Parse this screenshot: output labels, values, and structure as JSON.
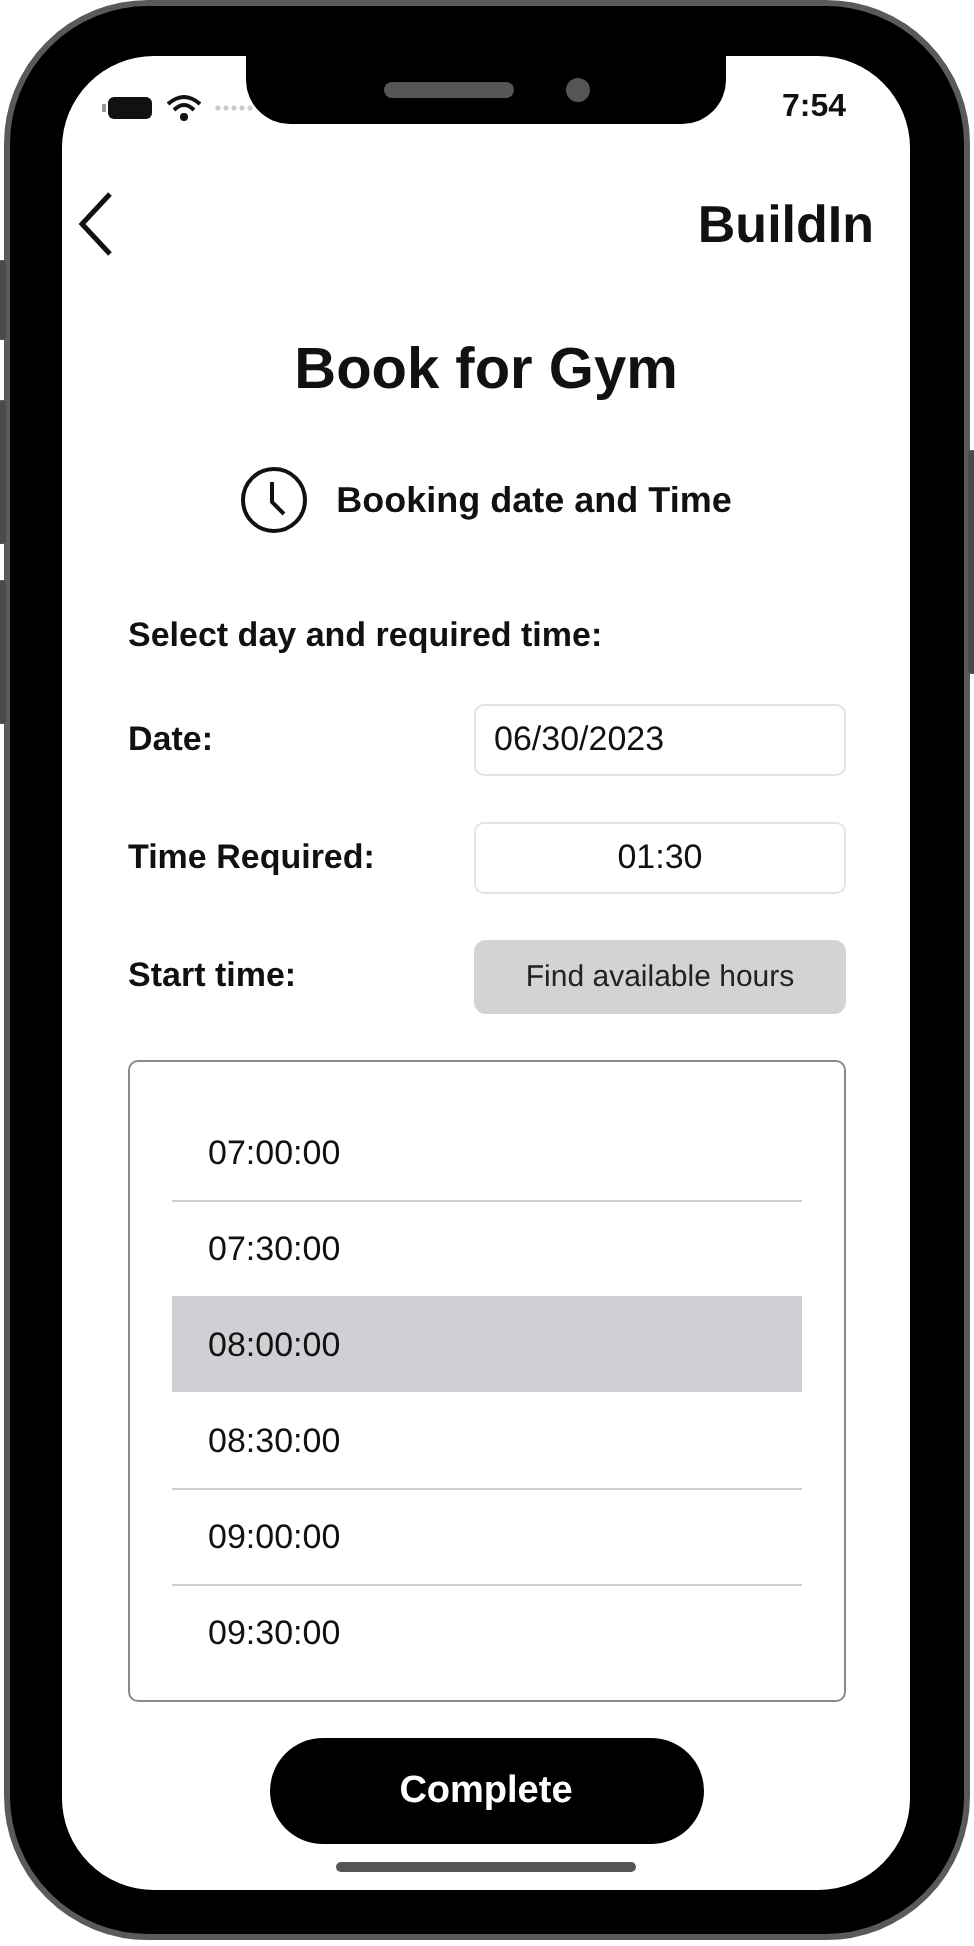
{
  "status_bar": {
    "time": "7:54"
  },
  "nav": {
    "title": "BuildIn"
  },
  "page_title": "Book for Gym",
  "section": {
    "label": "Booking date and Time"
  },
  "instruction": "Select day and required time:",
  "fields": [
    {
      "label": "Date:",
      "value": "06/30/2023",
      "kind": "date"
    },
    {
      "label": "Time Required:",
      "value": "01:30",
      "kind": "duration"
    }
  ],
  "start_time": {
    "label": "Start time:",
    "button": "Find available hours"
  },
  "times": [
    {
      "label": "07:00:00",
      "selected": false
    },
    {
      "label": "07:30:00",
      "selected": false
    },
    {
      "label": "08:00:00",
      "selected": true
    },
    {
      "label": "08:30:00",
      "selected": false
    },
    {
      "label": "09:00:00",
      "selected": false
    },
    {
      "label": "09:30:00",
      "selected": false
    }
  ],
  "complete_button": "Complete"
}
